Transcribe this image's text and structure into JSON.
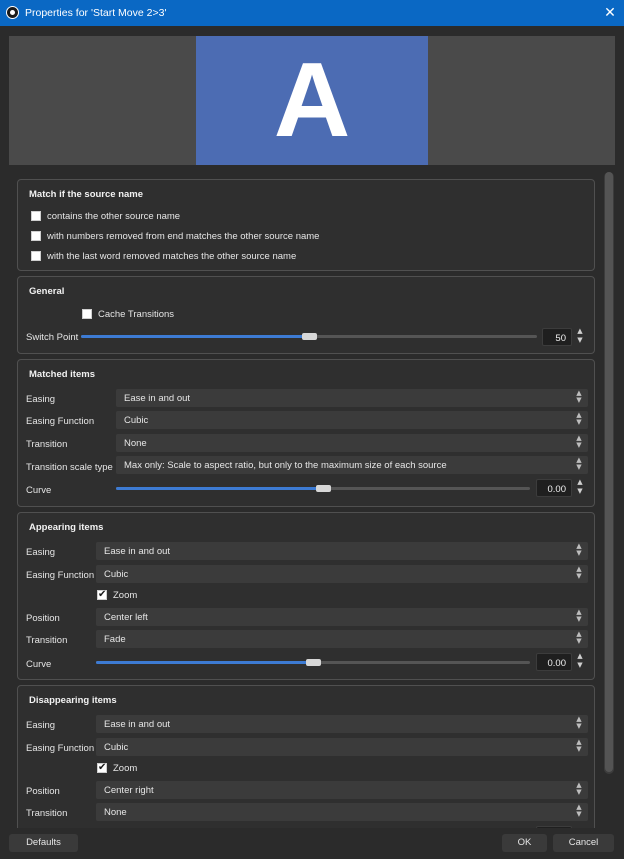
{
  "window": {
    "title": "Properties for 'Start Move 2>3'"
  },
  "preview": {
    "letter": "A"
  },
  "match_group": {
    "title": "Match if the source name",
    "options": [
      {
        "label": "contains the other source name",
        "checked": false
      },
      {
        "label": "with numbers removed from end matches the other source name",
        "checked": false
      },
      {
        "label": "with the last word removed matches the other source name",
        "checked": false
      }
    ]
  },
  "general": {
    "title": "General",
    "cache_label": "Cache Transitions",
    "cache_checked": false,
    "switch_label": "Switch Point",
    "switch_value": "50",
    "switch_fraction": 0.5
  },
  "matched": {
    "title": "Matched items",
    "easing_label": "Easing",
    "easing_value": "Ease in and out",
    "function_label": "Easing Function",
    "function_value": "Cubic",
    "transition_label": "Transition",
    "transition_value": "None",
    "scale_label": "Transition scale type",
    "scale_value": "Max only: Scale to aspect ratio, but only to the maximum size of each source",
    "curve_label": "Curve",
    "curve_value": "0.00",
    "curve_fraction": 0.5
  },
  "appearing": {
    "title": "Appearing items",
    "easing_label": "Easing",
    "easing_value": "Ease in and out",
    "function_label": "Easing Function",
    "function_value": "Cubic",
    "zoom_label": "Zoom",
    "zoom_checked": true,
    "position_label": "Position",
    "position_value": "Center left",
    "transition_label": "Transition",
    "transition_value": "Fade",
    "curve_label": "Curve",
    "curve_value": "0.00",
    "curve_fraction": 0.5
  },
  "disappearing": {
    "title": "Disappearing items",
    "easing_label": "Easing",
    "easing_value": "Ease in and out",
    "function_label": "Easing Function",
    "function_value": "Cubic",
    "zoom_label": "Zoom",
    "zoom_checked": true,
    "position_label": "Position",
    "position_value": "Center right",
    "transition_label": "Transition",
    "transition_value": "None"
  },
  "footer": {
    "defaults_label": "Defaults",
    "ok_label": "OK",
    "cancel_label": "Cancel"
  },
  "icons": {
    "app": "obs-logo-icon",
    "close": "close-icon",
    "combo_arrows": "updown-chevron-icon"
  },
  "colors": {
    "titlebar": "#0a68c4",
    "accent": "#3d7bd3",
    "preview_slide": "#4c6cb3"
  }
}
